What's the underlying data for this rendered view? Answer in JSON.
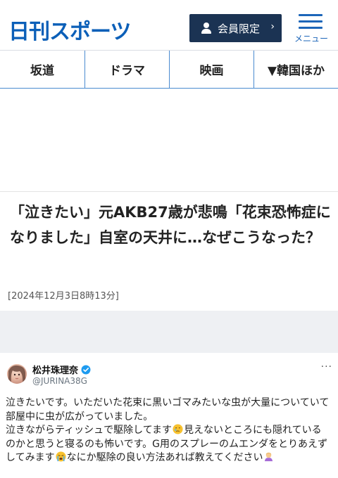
{
  "header": {
    "logo": "日刊スポーツ",
    "member_button": "会員限定",
    "member_chevron": "›",
    "menu_label": "メニュー"
  },
  "nav": {
    "items": [
      "坂道",
      "ドラマ",
      "映画",
      "▼韓国ほか"
    ]
  },
  "article": {
    "title": "「泣きたい」元AKB27歳が悲鳴「花束恐怖症になりました」自室の天井に…なぜこうなった？",
    "date": "[2024年12月3日8時13分]"
  },
  "tweet": {
    "display_name": "松井珠理奈",
    "handle": "@JURINA38G",
    "more": "···",
    "lines": [
      "泣きたいです。いただいた花束に黒いゴマみたいな虫が大量についていて",
      "部屋中に虫が広がっていました。",
      "泣きながらティッシュで駆除してます",
      "見えないところにも隠れている",
      "のかと思うと寝るのも怖いです。G用のスプレーのムエンダをとりあえず",
      "してみます",
      "なにか駆除の良い方法あれば教えてください"
    ]
  },
  "colors": {
    "brand_blue": "#0b5fb8",
    "member_button_bg": "#1b3353",
    "nav_border": "#4a8bd0",
    "verified_blue": "#1d9bf0"
  },
  "icons": {
    "member": "person-icon",
    "menu": "hamburger-icon",
    "verified": "verified-badge-icon",
    "emoji_1": "crying-face-emoji",
    "emoji_2": "loudly-crying-face-emoji",
    "emoji_3": "person-bowing-emoji"
  }
}
